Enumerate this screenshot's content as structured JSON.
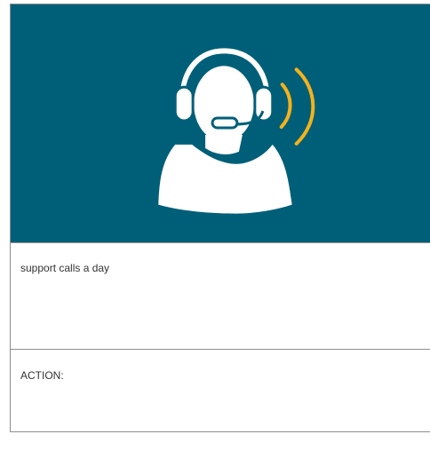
{
  "hero": {
    "icon": "customer-support-headset-icon",
    "background_color": "#005f78",
    "icon_color": "#ffffff",
    "sound_wave_color": "#f5b21a"
  },
  "stats_section": {
    "text": "support calls a day"
  },
  "action_section": {
    "label": "ACTION:"
  }
}
